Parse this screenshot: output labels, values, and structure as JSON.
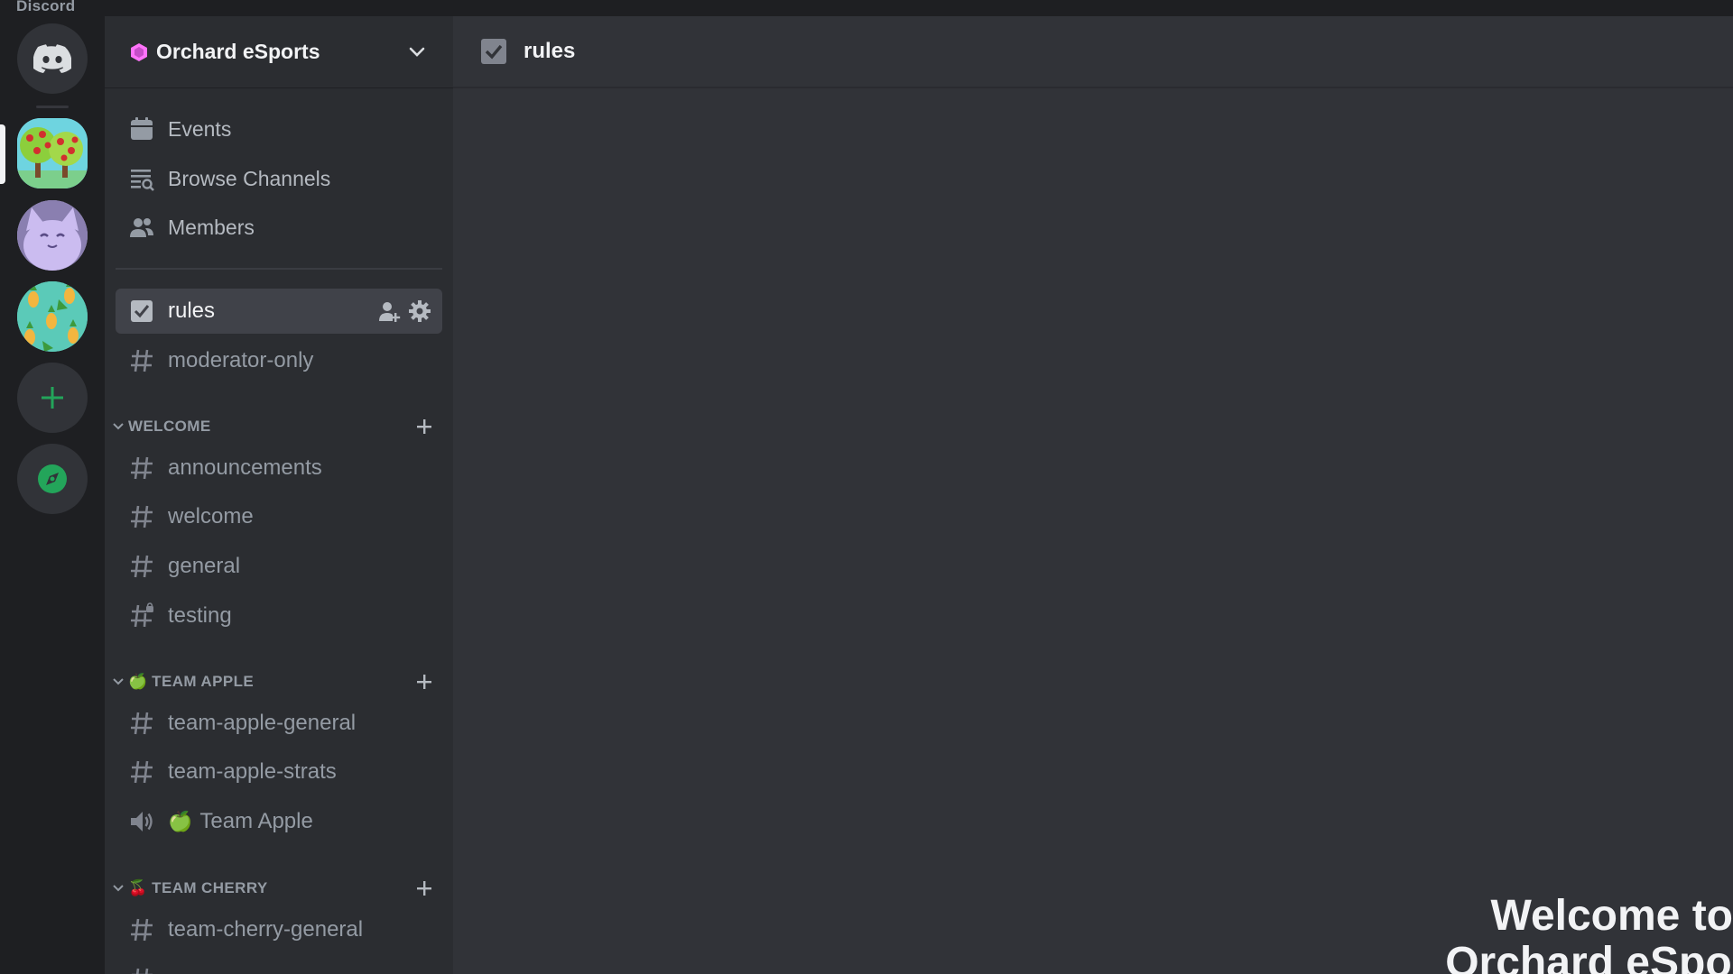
{
  "app": {
    "title": "Discord"
  },
  "server": {
    "name": "Orchard eSports"
  },
  "nav": [
    {
      "label": "Events",
      "icon": "calendar-icon"
    },
    {
      "label": "Browse Channels",
      "icon": "browse-channels-icon"
    },
    {
      "label": "Members",
      "icon": "members-icon"
    }
  ],
  "channels_top": [
    {
      "label": "rules",
      "icon": "rules-icon",
      "active": true
    },
    {
      "label": "moderator-only",
      "icon": "hashtag-icon"
    }
  ],
  "categories": [
    {
      "label": "WELCOME",
      "emoji": "",
      "channels": [
        "announcements",
        "welcome",
        "general",
        "testing"
      ]
    },
    {
      "label": "TEAM APPLE",
      "emoji": "🍏",
      "channels": [
        "team-apple-general",
        "team-apple-strats"
      ],
      "voice": {
        "emoji": "🍏",
        "label": "Team Apple"
      }
    },
    {
      "label": "TEAM CHERRY",
      "emoji": "🍒",
      "channels": [
        "team-cherry-general"
      ]
    }
  ],
  "main": {
    "channel_title": "rules",
    "welcome_line1": "Welcome to",
    "welcome_line2": "Orchard eSports"
  },
  "colors": {
    "background": "#313338",
    "sidebar": "#2b2d31",
    "rail": "#1e1f22",
    "active_channel": "#404249",
    "discover_green": "#23a55a"
  }
}
